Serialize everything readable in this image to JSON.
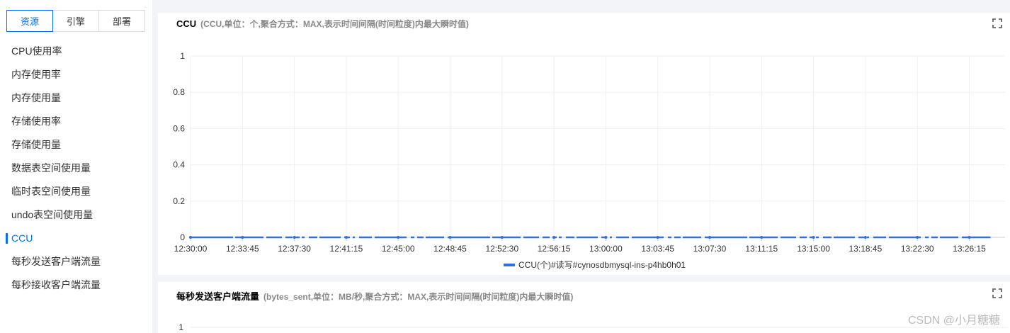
{
  "sidebar": {
    "tabs": [
      "资源",
      "引擎",
      "部署"
    ],
    "items": [
      "CPU使用率",
      "内存使用率",
      "内存使用量",
      "存储使用率",
      "存储使用量",
      "数据表空间使用量",
      "临时表空间使用量",
      "undo表空间使用量",
      "CCU",
      "每秒发送客户端流量",
      "每秒接收客户端流量"
    ]
  },
  "panel1": {
    "title": "CCU",
    "subtitle": "(CCU,单位：个,聚合方式：MAX,表示时间间隔(时间粒度)内最大瞬时值)",
    "legend": "CCU(个)#读写#cynosdbmysql-ins-p4hb0h01"
  },
  "panel2": {
    "title": "每秒发送客户端流量",
    "subtitle": "(bytes_sent,单位：MB/秒,聚合方式：MAX,表示时间间隔(时间粒度)内最大瞬时值)",
    "y_top_tick": "1"
  },
  "watermark": "CSDN @小月糖糖",
  "chart_data": {
    "type": "line",
    "title": "CCU",
    "ylim": [
      0,
      1
    ],
    "yticks": [
      "1",
      "0.8",
      "0.6",
      "0.4",
      "0.2",
      "0"
    ],
    "x": [
      "12:30:00",
      "12:33:45",
      "12:37:30",
      "12:41:15",
      "12:45:00",
      "12:48:45",
      "12:52:30",
      "12:56:15",
      "13:00:00",
      "13:03:45",
      "13:07:30",
      "13:11:15",
      "13:15:00",
      "13:18:45",
      "13:22:30",
      "13:26:15"
    ],
    "series": [
      {
        "name": "CCU(个)#读写#cynosdbmysql-ins-p4hb0h01",
        "values": [
          0,
          0,
          0,
          0,
          0,
          0,
          0,
          0,
          0,
          0,
          0,
          0,
          0,
          0,
          0,
          0
        ]
      }
    ],
    "color": "#2c6fe8",
    "grid": true,
    "legend_position": "bottom"
  }
}
